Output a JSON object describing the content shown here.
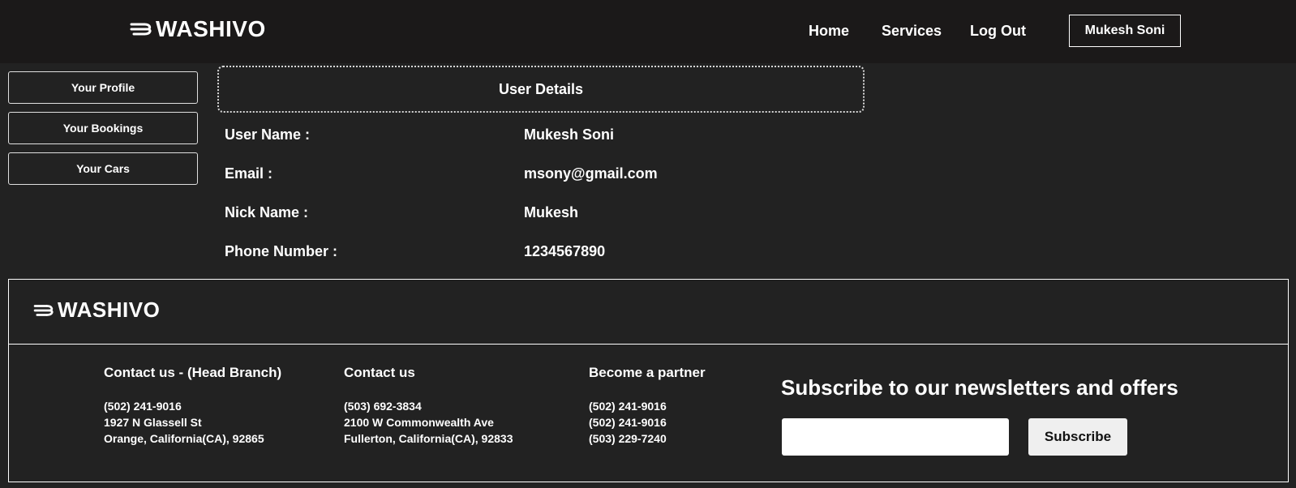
{
  "brand": {
    "name": "WASHIVO",
    "icon": "wind-icon"
  },
  "nav": {
    "home": "Home",
    "services": "Services",
    "logout": "Log Out",
    "user": "Mukesh Soni"
  },
  "sidebar": {
    "items": [
      {
        "label": "Your Profile"
      },
      {
        "label": "Your Bookings"
      },
      {
        "label": "Your Cars"
      }
    ]
  },
  "details": {
    "title": "User Details",
    "rows": [
      {
        "label": "User Name :",
        "value": "Mukesh Soni"
      },
      {
        "label": "Email :",
        "value": "msony@gmail.com"
      },
      {
        "label": "Nick Name :",
        "value": "Mukesh"
      },
      {
        "label": "Phone Number :",
        "value": "1234567890"
      }
    ]
  },
  "footer": {
    "columns": [
      {
        "title": "Contact us - (Head Branch)",
        "lines": [
          "(502) 241-9016",
          "1927 N Glassell St",
          "Orange, California(CA), 92865"
        ]
      },
      {
        "title": "Contact us",
        "lines": [
          "(503) 692-3834",
          "2100 W Commonwealth Ave",
          "Fullerton, California(CA), 92833"
        ]
      },
      {
        "title": "Become a partner",
        "lines": [
          "(502) 241-9016",
          "(502) 241-9016",
          "(503) 229-7240"
        ]
      }
    ],
    "newsletter": {
      "title": "Subscribe to our newsletters and offers",
      "input_value": "",
      "button": "Subscribe"
    }
  },
  "colors": {
    "background": "#222222",
    "topbar": "#1b1919",
    "text": "#ffffff",
    "subscribe_button": "#efefef"
  }
}
